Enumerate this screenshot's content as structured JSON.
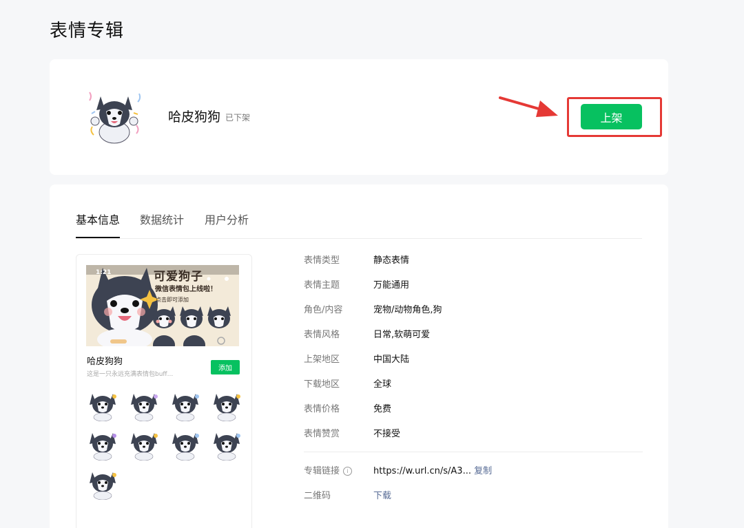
{
  "page": {
    "title": "表情专辑"
  },
  "header": {
    "album_name": "哈皮狗狗",
    "status": "已下架",
    "list_button_label": "上架"
  },
  "tabs": [
    {
      "label": "基本信息",
      "active": true
    },
    {
      "label": "数据统计",
      "active": false
    },
    {
      "label": "用户分析",
      "active": false
    }
  ],
  "preview": {
    "banner_time": "1:21",
    "banner_title": "可爱狗子",
    "banner_subtitle": "微信表情包上线啦！",
    "banner_hint": "点击即可添加",
    "name": "哈皮狗狗",
    "description": "这是一只永远充满表情包buff...",
    "add_button_label": "添加",
    "sticker_count": 9
  },
  "info": {
    "rows": [
      {
        "label": "表情类型",
        "value": "静态表情"
      },
      {
        "label": "表情主题",
        "value": "万能通用"
      },
      {
        "label": "角色/内容",
        "value": "宠物/动物角色,狗"
      },
      {
        "label": "表情风格",
        "value": "日常,软萌可爱"
      },
      {
        "label": "上架地区",
        "value": "中国大陆"
      },
      {
        "label": "下载地区",
        "value": "全球"
      },
      {
        "label": "表情价格",
        "value": "免费"
      },
      {
        "label": "表情赞赏",
        "value": "不接受"
      }
    ],
    "link_label": "专辑链接",
    "link_value": "https://w.url.cn/s/A3...",
    "copy_label": "复制",
    "qr_label": "二维码",
    "download_label": "下载",
    "info_icon_glyph": "i"
  },
  "colors": {
    "accent_green": "#07c160",
    "annotation_red": "#e53935",
    "link_blue": "#576b95"
  }
}
